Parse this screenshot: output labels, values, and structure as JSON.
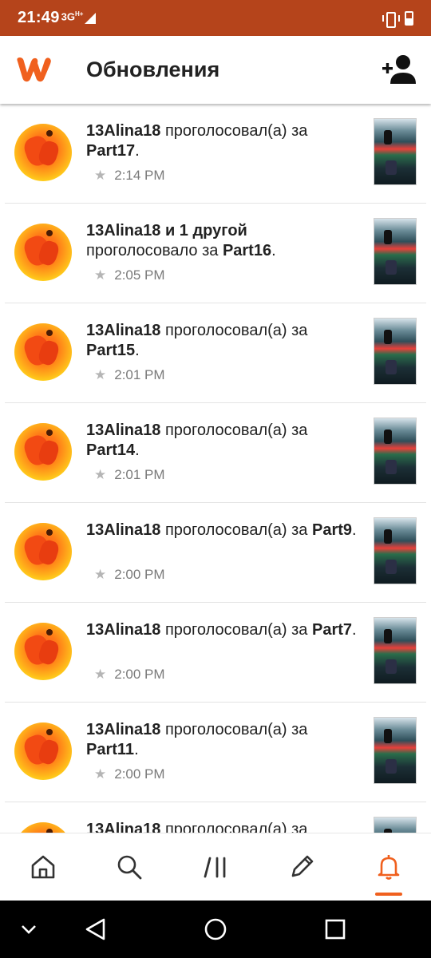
{
  "status_bar": {
    "time": "21:49",
    "network": "3G",
    "network_sup": "H+"
  },
  "header": {
    "title": "Обновления"
  },
  "colors": {
    "status_bar": "#b5441b",
    "accent": "#f0601e"
  },
  "icons": {
    "logo": "wattpad-logo",
    "add_friend": "add-person-icon",
    "nav": [
      "home-icon",
      "search-icon",
      "library-icon",
      "pencil-icon",
      "bell-icon"
    ],
    "system": [
      "chevron-down-icon",
      "back-triangle-icon",
      "home-circle-icon",
      "recents-square-icon"
    ]
  },
  "notifications": [
    {
      "user": "13Alina18",
      "extra": "",
      "action": "проголосовал(а) за",
      "part": "Part17",
      "time": "2:14 PM"
    },
    {
      "user": "13Alina18",
      "extra": "и 1 другой",
      "action": "проголосовало за",
      "part": "Part16",
      "time": "2:05 PM"
    },
    {
      "user": "13Alina18",
      "extra": "",
      "action": "проголосовал(а) за",
      "part": "Part15",
      "time": "2:01 PM"
    },
    {
      "user": "13Alina18",
      "extra": "",
      "action": "проголосовал(а) за",
      "part": "Part14",
      "time": "2:01 PM"
    },
    {
      "user": "13Alina18",
      "extra": "",
      "action": "проголосовал(а) за",
      "part": "Part9",
      "time": "2:00 PM"
    },
    {
      "user": "13Alina18",
      "extra": "",
      "action": "проголосовал(а) за",
      "part": "Part7",
      "time": "2:00 PM"
    },
    {
      "user": "13Alina18",
      "extra": "",
      "action": "проголосовал(а) за",
      "part": "Part11",
      "time": "2:00 PM"
    },
    {
      "user": "13Alina18",
      "extra": "",
      "action": "проголосовал(а) за",
      "part": "",
      "time": ""
    }
  ],
  "bottom_nav": {
    "active": "notifications"
  }
}
